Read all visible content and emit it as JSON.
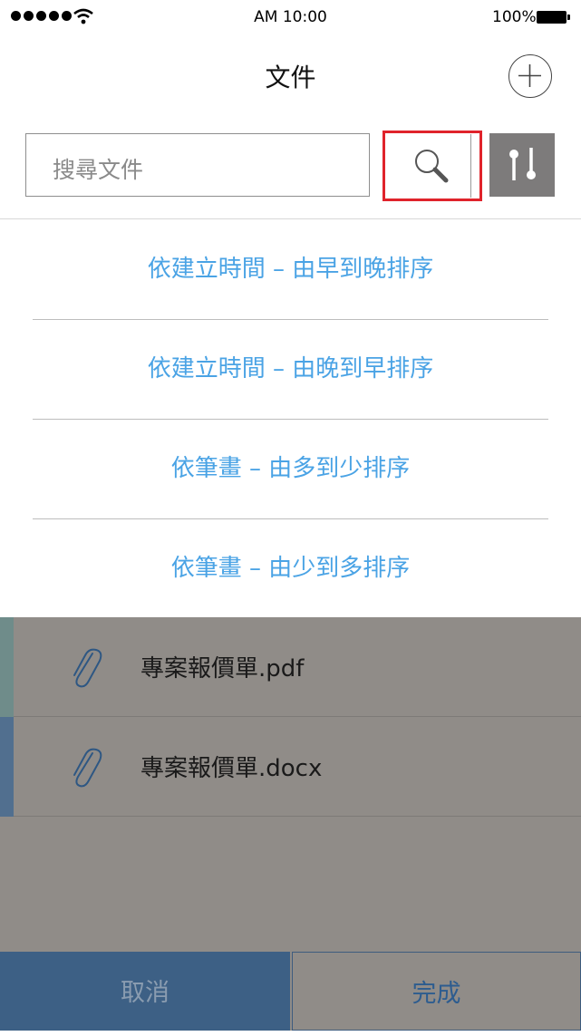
{
  "status_bar": {
    "time": "AM 10:00",
    "battery": "100%"
  },
  "header": {
    "title": "文件"
  },
  "search": {
    "placeholder": "搜尋文件"
  },
  "sort_menu": {
    "items": [
      "依建立時間 – 由早到晚排序",
      "依建立時間 – 由晚到早排序",
      "依筆畫 – 由多到少排序",
      "依筆畫 – 由少到多排序"
    ]
  },
  "files": [
    {
      "name": "專案報價單.pdf",
      "accent": "#6f8c8a"
    },
    {
      "name": "專案報價單.docx",
      "accent": "#516f8f"
    }
  ],
  "actions": {
    "cancel": "取消",
    "done": "完成"
  },
  "colors": {
    "accent_text": "#4aa3e5",
    "highlight_border": "#e0232b",
    "cancel_bg": "#3d6085",
    "overlay": "#908c88"
  },
  "icons": [
    "signal-dots-icon",
    "wifi-icon",
    "battery-icon",
    "plus-circle-icon",
    "search-icon",
    "filter-sliders-icon",
    "paperclip-icon"
  ]
}
